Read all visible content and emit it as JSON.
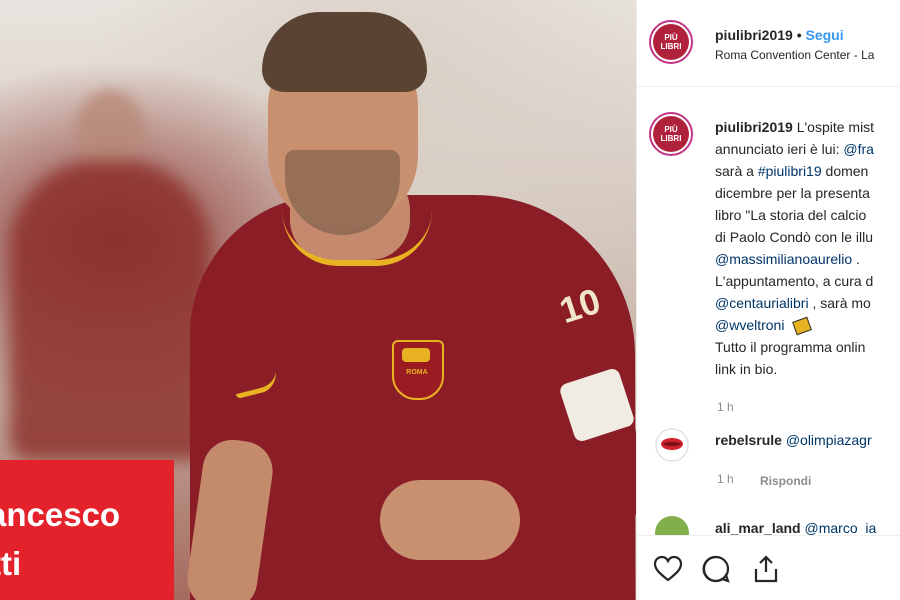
{
  "photo": {
    "overlay_name_line1": "ancesco",
    "overlay_name_line2": "tti",
    "jersey_number": "10",
    "crest_text": "ROMA"
  },
  "post": {
    "header": {
      "username": "piulibri2019",
      "separator": "•",
      "follow_label": "Segui",
      "location": "Roma Convention Center - La",
      "avatar_text": "PIÙ LIBRI"
    },
    "caption": {
      "username": "piulibri2019",
      "lines": [
        "L'ospite mist",
        "annunciato ieri è lui: ",
        "sarà a ",
        "dicembre per la presenta",
        "libro \"La storia del calcio",
        "di Paolo Condò con le illu",
        "",
        "L'appuntamento, a cura d",
        "",
        "",
        "Tutto il programma onlin",
        "link in bio."
      ],
      "mention_fra": "@fra",
      "hashtag": "#piulibri19",
      "line3_tail": " domen",
      "mention_massimiliano": "@massimilianoaurelio",
      "line7_tail": " .",
      "mention_centauria": "@centaurialibri",
      "line9_tail": " , sarà mo",
      "mention_veltroni": "@wveltroni",
      "time": "1 h"
    },
    "comments": [
      {
        "username": "rebelsrule",
        "text": "@olimpiazagr",
        "time": "1 h",
        "reply_label": "Rispondi"
      },
      {
        "username": "ali_mar_land",
        "text": "@marco_ia"
      }
    ],
    "actions": {
      "like_icon": "heart-icon",
      "comment_icon": "comment-icon",
      "share_icon": "share-icon"
    }
  },
  "colors": {
    "link": "#003569",
    "follow": "#3897f0",
    "banner": "#e3222b",
    "jersey": "#8b1d27"
  }
}
